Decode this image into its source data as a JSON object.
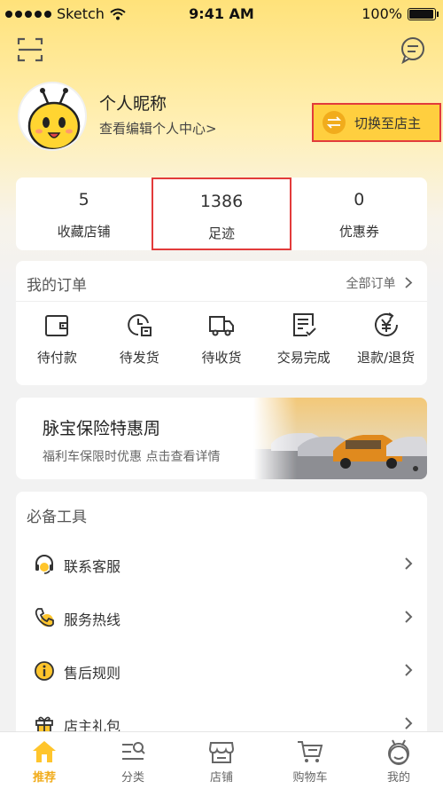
{
  "status_bar": {
    "carrier": "Sketch",
    "time": "9:41 AM",
    "battery": "100%"
  },
  "profile": {
    "nickname": "个人昵称",
    "edit_link": "查看编辑个人中心>",
    "switch_label": "切换至店主"
  },
  "stats": [
    {
      "value": "5",
      "label": "收藏店铺"
    },
    {
      "value": "1386",
      "label": "足迹"
    },
    {
      "value": "0",
      "label": "优惠券"
    }
  ],
  "orders": {
    "title": "我的订单",
    "all_label": "全部订单",
    "items": [
      {
        "label": "待付款",
        "icon": "wallet-icon"
      },
      {
        "label": "待发货",
        "icon": "pending-ship-icon"
      },
      {
        "label": "待收货",
        "icon": "truck-icon"
      },
      {
        "label": "交易完成",
        "icon": "completed-doc-icon"
      },
      {
        "label": "退款/退货",
        "icon": "refund-icon"
      }
    ]
  },
  "banner": {
    "title": "脉宝保险特惠周",
    "subtitle": "福利车保限时优惠 点击查看详情"
  },
  "tools": {
    "title": "必备工具",
    "items": [
      {
        "label": "联系客服",
        "icon": "headset-icon"
      },
      {
        "label": "服务热线",
        "icon": "phone-icon"
      },
      {
        "label": "售后规则",
        "icon": "info-icon"
      },
      {
        "label": "店主礼包",
        "icon": "gift-icon"
      }
    ]
  },
  "tabbar": [
    {
      "label": "推荐",
      "icon": "home-icon",
      "active": true
    },
    {
      "label": "分类",
      "icon": "category-icon"
    },
    {
      "label": "店铺",
      "icon": "shop-icon"
    },
    {
      "label": "购物车",
      "icon": "cart-icon"
    },
    {
      "label": "我的",
      "icon": "profile-icon"
    }
  ],
  "colors": {
    "accent": "#ffcf3f",
    "accent_dark": "#f1ac1c",
    "highlight_border": "#e23b3b",
    "background": "#f2f2f2"
  }
}
